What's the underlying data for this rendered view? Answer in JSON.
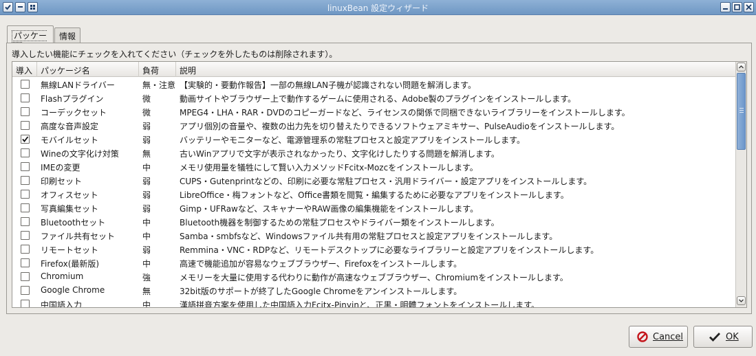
{
  "window": {
    "title": "linuxBean 設定ウィザード"
  },
  "tabs": [
    {
      "label": "パッケージ"
    },
    {
      "label": "情報"
    }
  ],
  "instruction": "導入したい機能にチェックを入れてください（チェックを外したものは削除されます）。",
  "columns": {
    "install": "導入",
    "package": "パッケージ名",
    "load": "負荷",
    "desc": "説明"
  },
  "rows": [
    {
      "checked": false,
      "name": "無線LANドライバー",
      "load": "無・注意",
      "desc": "【実験的・要動作報告】一部の無線LAN子機が認識されない問題を解消します。"
    },
    {
      "checked": false,
      "name": "Flashプラグイン",
      "load": "微",
      "desc": "動画サイトやブラウザー上で動作するゲームに使用される、Adobe製のプラグインをインストールします。"
    },
    {
      "checked": false,
      "name": "コーデックセット",
      "load": "微",
      "desc": "MPEG4・LHA・RAR・DVDのコピーガードなど、ライセンスの関係で同梱できないライブラリーをインストールします。"
    },
    {
      "checked": false,
      "name": "高度な音声設定",
      "load": "弱",
      "desc": "アプリ個別の音量や、複数の出力先を切り替えたりできるソフトウェアミキサー、PulseAudioをインストールします。"
    },
    {
      "checked": true,
      "name": "モバイルセット",
      "load": "弱",
      "desc": "バッテリーやモニターなど、電源管理系の常駐プロセスと設定アプリをインストールします。"
    },
    {
      "checked": false,
      "name": "Wineの文字化け対策",
      "load": "無",
      "desc": "古いWinアプリで文字が表示されなかったり、文字化けしたりする問題を解消します。"
    },
    {
      "checked": false,
      "name": "IMEの変更",
      "load": "中",
      "desc": "メモリ使用量を犠牲にして賢い入力メソッドFcitx-Mozcをインストールします。"
    },
    {
      "checked": false,
      "name": "印刷セット",
      "load": "弱",
      "desc": "CUPS・Gutenprintなどの、印刷に必要な常駐プロセス・汎用ドライバー・設定アプリをインストールします。"
    },
    {
      "checked": false,
      "name": "オフィスセット",
      "load": "弱",
      "desc": "LibreOffice・梅フォントなど、Office書類を閲覧・編集するために必要なアプリをインストールします。"
    },
    {
      "checked": false,
      "name": "写真編集セット",
      "load": "弱",
      "desc": "Gimp・UFRawなど、スキャナーやRAW画像の編集機能をインストールします。"
    },
    {
      "checked": false,
      "name": "Bluetoothセット",
      "load": "中",
      "desc": "Bluetooth機器を制御するための常駐プロセスやドライバー類をインストールします。"
    },
    {
      "checked": false,
      "name": "ファイル共有セット",
      "load": "中",
      "desc": "Samba・smbfsなど、Windowsファイル共有用の常駐プロセスと設定アプリをインストールします。"
    },
    {
      "checked": false,
      "name": "リモートセット",
      "load": "弱",
      "desc": "Remmina・VNC・RDPなど、リモートデスクトップに必要なライブラリーと設定アプリをインストールします。"
    },
    {
      "checked": false,
      "name": "Firefox(最新版)",
      "load": "中",
      "desc": "高速で機能追加が容易なウェブブラウザー、Firefoxをインストールします。"
    },
    {
      "checked": false,
      "name": "Chromium",
      "load": "強",
      "desc": "メモリーを大量に使用する代わりに動作が高速なウェブブラウザー、Chromiumをインストールします。"
    },
    {
      "checked": false,
      "name": "Google Chrome",
      "load": "無",
      "desc": "32bit版のサポートが終了したGoogle Chromeをアンインストールします。"
    },
    {
      "checked": false,
      "name": "中国語入力",
      "load": "中",
      "desc": "漢語拼音方案を使用した中国語入力Fcitx-Pinyinと、正黒・明體フォントをインストールします。"
    }
  ],
  "buttons": {
    "cancel": "Cancel",
    "ok": "OK"
  }
}
